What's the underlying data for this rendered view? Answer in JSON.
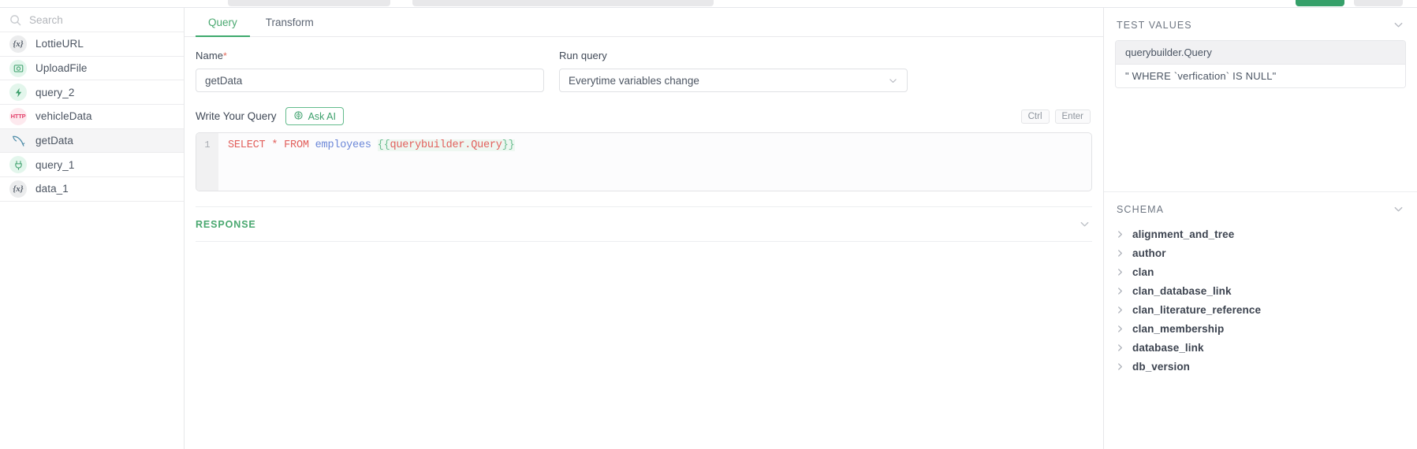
{
  "topbar": {
    "buttons": [
      "",
      "",
      "",
      ""
    ]
  },
  "sidebar": {
    "search": {
      "placeholder": "Search",
      "value": "",
      "icon": "search-icon"
    },
    "items": [
      {
        "label": "LottieURL",
        "icon": "variable-icon",
        "active": false
      },
      {
        "label": "UploadFile",
        "icon": "image-upload-icon",
        "active": false
      },
      {
        "label": "query_2",
        "icon": "lightning-bolt-icon",
        "active": false
      },
      {
        "label": "vehicleData",
        "icon": "http-icon",
        "active": false
      },
      {
        "label": "getData",
        "icon": "mysql-dolphin-icon",
        "active": true
      },
      {
        "label": "query_1",
        "icon": "plug-icon",
        "active": false
      },
      {
        "label": "data_1",
        "icon": "variable-icon",
        "active": false
      }
    ]
  },
  "main": {
    "tabs": [
      {
        "label": "Query",
        "active": true
      },
      {
        "label": "Transform",
        "active": false
      }
    ],
    "name_field": {
      "label": "Name",
      "required_marker": "*",
      "value": "getData",
      "placeholder": ""
    },
    "run_query": {
      "label": "Run query",
      "value": "Everytime variables change",
      "caret_icon": "chevron-down-icon"
    },
    "write_query": {
      "label": "Write Your Query",
      "ask_ai_label": "Ask AI",
      "ask_ai_icon": "sparkle-ai-icon",
      "keys": [
        "Ctrl",
        "Enter"
      ]
    },
    "editor": {
      "line_number": "1",
      "tokens": {
        "select": "SELECT",
        "star": " * ",
        "from": "FROM",
        "table": " employees ",
        "mustache_open": "{{",
        "mustache_path": "querybuilder.Query",
        "mustache_close": "}}"
      },
      "full_text": "SELECT * FROM employees {{querybuilder.Query}}"
    },
    "response": {
      "title": "RESPONSE",
      "caret_icon": "chevron-down-icon"
    }
  },
  "right": {
    "test_values": {
      "title": "TEST VALUES",
      "caret_icon": "chevron-down-icon",
      "key": "querybuilder.Query",
      "value": "\" WHERE `verfication` IS NULL\""
    },
    "schema": {
      "title": "SCHEMA",
      "caret_icon": "chevron-down-icon",
      "tables": [
        "alignment_and_tree",
        "author",
        "clan",
        "clan_database_link",
        "clan_literature_reference",
        "clan_membership",
        "database_link",
        "db_version"
      ]
    }
  },
  "colors": {
    "accent_green": "#3ea96d",
    "required_red": "#e2685a",
    "keyword_red": "#e2605c",
    "table_blue": "#6b87d8",
    "mustache_green": "#6dbf92",
    "http_pink": "#e2416b"
  }
}
